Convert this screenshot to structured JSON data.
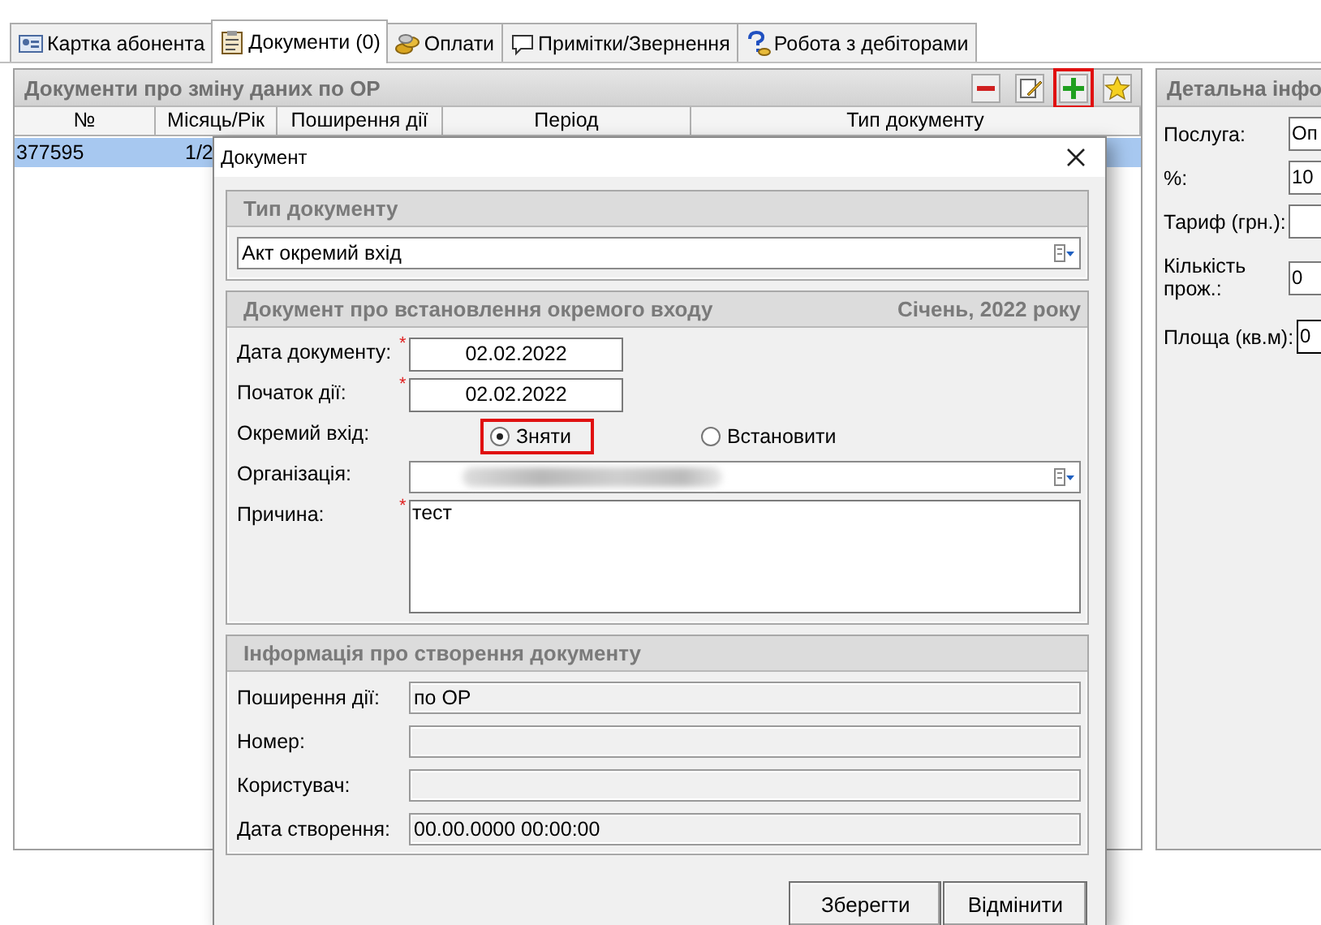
{
  "tabs": [
    {
      "label": "Картка абонента",
      "kind": "card",
      "selected": false
    },
    {
      "label": "Документи (0)",
      "kind": "clipboard",
      "selected": true
    },
    {
      "label": "Оплати",
      "kind": "coins",
      "selected": false
    },
    {
      "label": "Примітки/Звернення",
      "kind": "chat",
      "selected": false
    },
    {
      "label": "Робота з дебіторами",
      "kind": "help",
      "selected": false
    }
  ],
  "documents_panel": {
    "title": "Документи про зміну даних по ОР",
    "toolbar": [
      {
        "kind": "remove",
        "highlighted": false
      },
      {
        "kind": "edit",
        "highlighted": false
      },
      {
        "kind": "add",
        "highlighted": true
      },
      {
        "kind": "favorite",
        "highlighted": false
      }
    ],
    "table": {
      "columns": [
        "№",
        "Місяць/Рік",
        "Поширення дії",
        "Період",
        "Тип документу"
      ],
      "rows": [
        {
          "cells": [
            "377595",
            "1/2"
          ],
          "selected": true
        }
      ]
    }
  },
  "details_panel": {
    "title": "Детальна інфо",
    "fields": [
      {
        "label": "Послуга:",
        "value": "Оп"
      },
      {
        "label": "%:",
        "value": "10"
      },
      {
        "label": "Тариф (грн.):"
      },
      {
        "label": "Кількість прож.:",
        "value": "0"
      },
      {
        "label": "Площа (кв.м):",
        "value": "0"
      }
    ]
  },
  "dialog": {
    "title": "Документ",
    "type_section": {
      "title": "Тип документу",
      "value": "Акт окремий вхід"
    },
    "document_section": {
      "title": "Документ про встановлення окремого входу",
      "period": "Січень, 2022 року",
      "fields": [
        {
          "kind": "text",
          "label": "Дата документу:",
          "required_mark": "*",
          "value": "02.02.2022"
        },
        {
          "kind": "text",
          "label": "Початок дії:",
          "required_mark": "*",
          "value": "02.02.2022"
        },
        {
          "kind": "radio",
          "label": "Окремий вхід:",
          "options": [
            {
              "label": "Зняти",
              "selected": true,
              "highlighted": true
            },
            {
              "label": "Встановити",
              "selected": false,
              "highlighted": false
            }
          ]
        },
        {
          "kind": "combo",
          "label": "Організація:",
          "redacted": true
        },
        {
          "kind": "memo",
          "label": "Причина:",
          "required_mark": "*",
          "value": "тест"
        }
      ]
    },
    "info_section": {
      "title": "Інформація про створення документу",
      "fields": [
        {
          "label": "Поширення дії:",
          "value": "по ОР"
        },
        {
          "label": "Номер:"
        },
        {
          "label": "Користувач:"
        },
        {
          "label": "Дата створення:",
          "value": "00.00.0000 00:00:00"
        }
      ]
    },
    "buttons": [
      "Зберегти",
      "Відмінити"
    ]
  }
}
